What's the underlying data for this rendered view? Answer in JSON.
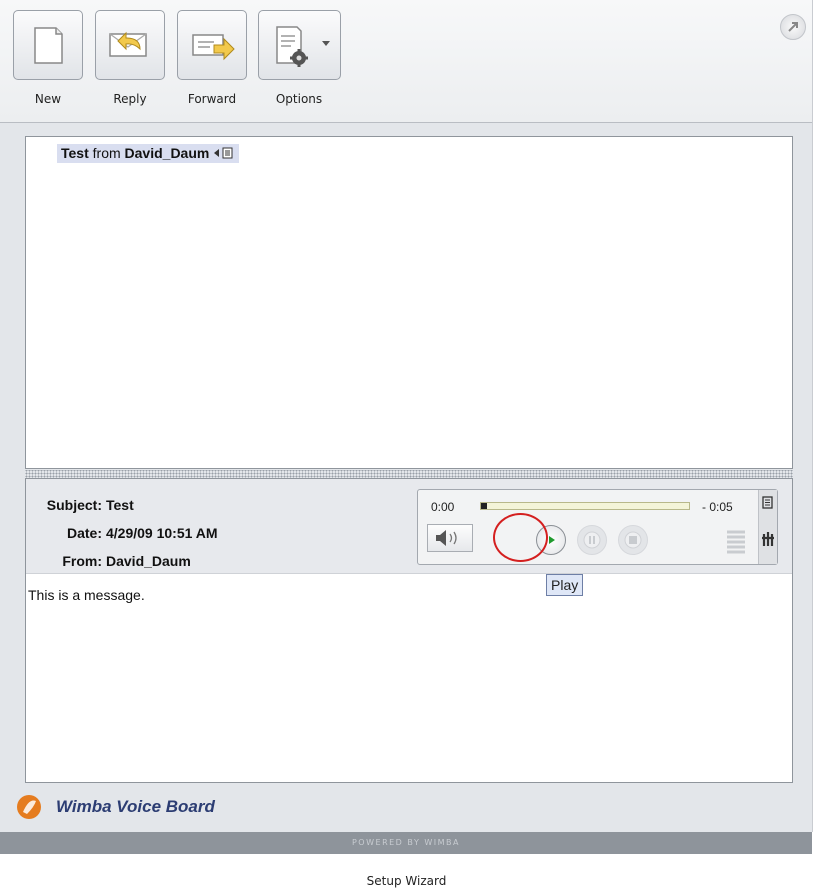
{
  "toolbar": {
    "new_label": "New",
    "reply_label": "Reply",
    "forward_label": "Forward",
    "options_label": "Options"
  },
  "thread": {
    "subject": "Test",
    "from_word": "from",
    "author": "David_Daum"
  },
  "message": {
    "subject_label": "Subject:",
    "subject": "Test",
    "date_label": "Date:",
    "date": "4/29/09 10:51 AM",
    "from_label": "From:",
    "from": "David_Daum",
    "body": "This is a message."
  },
  "player": {
    "elapsed": "0:00",
    "remaining": "- 0:05",
    "progress_fraction": 0.03,
    "tooltip": "Play"
  },
  "brand": {
    "name": "Wimba Voice Board",
    "powered_by": "POWERED BY WIMBA",
    "accent_color": "#e57c1f"
  },
  "footer": {
    "link": "Setup Wizard"
  }
}
